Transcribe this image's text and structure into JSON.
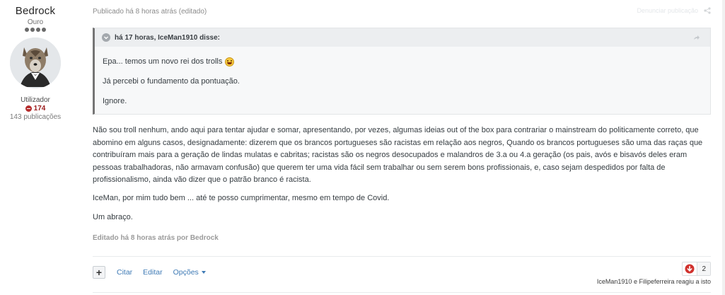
{
  "author": {
    "name": "Bedrock",
    "rank": "Ouro",
    "rank_dots": 4,
    "group": "Utilizador",
    "reputation": "174",
    "posts": "143 publicações"
  },
  "post": {
    "meta": "Publicado há 8 horas atrás (editado)",
    "report_link": "Denunciar publicação",
    "quote": {
      "header": "há 17 horas, IceMan1910 disse:",
      "lines": [
        "Epa... temos um novo rei dos trolls",
        "Já percebi o fundamento da pontuação.",
        "Ignore."
      ]
    },
    "paragraphs": [
      "Não sou troll nenhum, ando aqui para tentar ajudar e somar, apresentando, por vezes, algumas ideias out of the box para contrariar o mainstream do politicamente correto, que abomino em alguns casos, designadamente: dizerem que os brancos portugueses são racistas em relação aos negros, Quando os brancos portugueses são uma das raças que contribuíram mais para a geração de lindas mulatas e cabritas; racistas são os negros desocupados e malandros de 3.a ou 4.a geração (os pais, avós e bisavós deles eram pessoas trabalhadoras, não armavam confusão) que querem ter uma vida fácil sem trabalhar ou sem serem bons profissionais, e, caso sejam despedidos por falta de profissionalismo, ainda vão dizer que o patrão branco é racista.",
      "IceMan, por mim tudo bem ... até te posso cumprimentar, mesmo em tempo de Covid.",
      "Um abraço."
    ],
    "edited_note": "Editado há 8 horas atrás por Bedrock",
    "actions": {
      "add": "+",
      "quote": "Citar",
      "edit": "Editar",
      "options": "Opções"
    },
    "reactions": {
      "count": "2",
      "reacted_text": "IceMan1910 e Filipeferreira reagiu a isto"
    }
  },
  "colors": {
    "link": "#3e7ab5",
    "reputation_negative": "#b52c2c",
    "quote_border": "#757575"
  }
}
